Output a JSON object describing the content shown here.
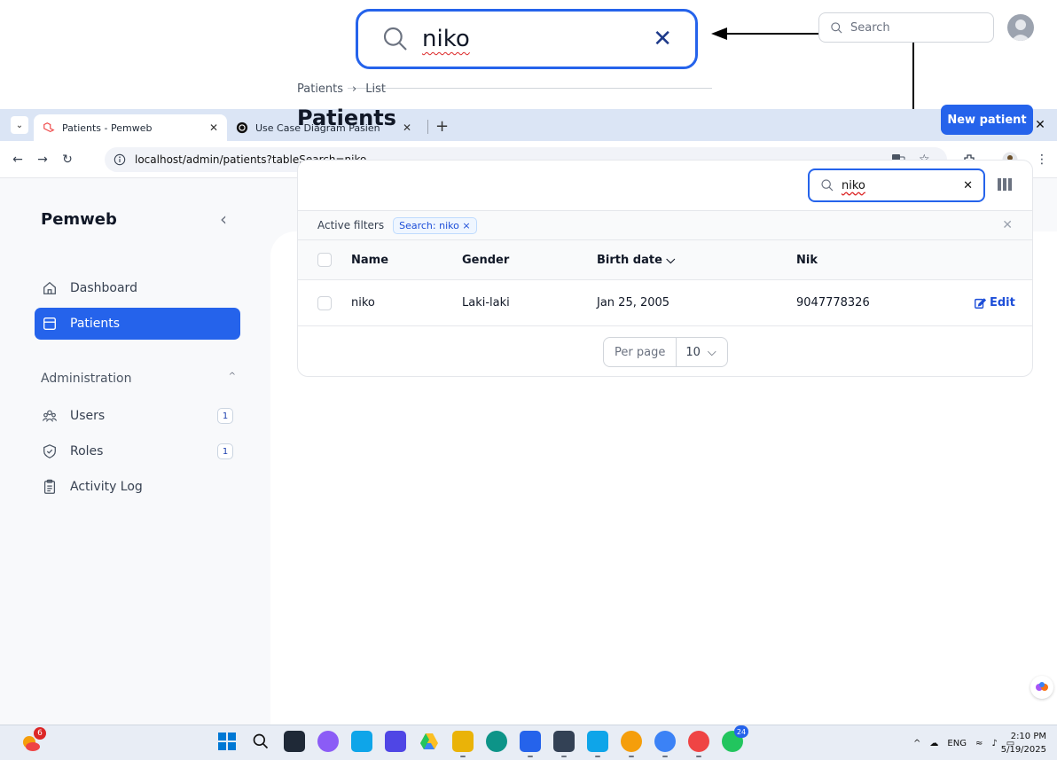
{
  "zoom_callout": {
    "search_value": "niko",
    "clear": "✕"
  },
  "browser": {
    "tabs": [
      {
        "title": "Patients - Pemweb",
        "close": "✕",
        "active": true
      },
      {
        "title": "Use Case Diagram Pasien",
        "close": "✕",
        "active": false
      }
    ],
    "new_tab": "+",
    "window_controls": [
      "—",
      "❐",
      "✕"
    ],
    "url": "localhost/admin/patients?tableSearch=niko"
  },
  "sidebar": {
    "brand": "Pemweb",
    "collapse": "‹",
    "items": [
      {
        "label": "Dashboard",
        "active": false
      },
      {
        "label": "Patients",
        "active": true
      }
    ],
    "group": {
      "label": "Administration",
      "chevron": "^"
    },
    "group_items": [
      {
        "label": "Users",
        "badge": "1"
      },
      {
        "label": "Roles",
        "badge": "1"
      },
      {
        "label": "Activity Log",
        "badge": ""
      }
    ]
  },
  "topbar": {
    "search_placeholder": "Search"
  },
  "page": {
    "breadcrumb": [
      "Patients",
      "›",
      "List"
    ],
    "title": "Patients",
    "new_button": "New patient"
  },
  "table": {
    "search_value": "niko",
    "search_clear": "✕",
    "filters_label": "Active filters",
    "filter_chip": "Search: niko ×",
    "filters_clear": "✕",
    "columns": {
      "name": "Name",
      "gender": "Gender",
      "birth": "Birth date ⌵",
      "nik": "Nik"
    },
    "rows": [
      {
        "name": "niko",
        "gender": "Laki-laki",
        "birth": "Jan 25, 2005",
        "nik": "9047778326",
        "action": "Edit"
      }
    ],
    "per_page_label": "Per page",
    "per_page_value": "10",
    "per_page_chevron": "⌵"
  },
  "taskbar": {
    "weather_badge": "6",
    "notif_badge": "24",
    "tray": {
      "lang": "ENG"
    },
    "clock": {
      "time": "2:10 PM",
      "date": "5/19/2025"
    }
  },
  "colors": {
    "primary": "#2563eb",
    "sidebar_bg": "#f8f9fb",
    "tabbar_bg": "#dbe5f5"
  }
}
